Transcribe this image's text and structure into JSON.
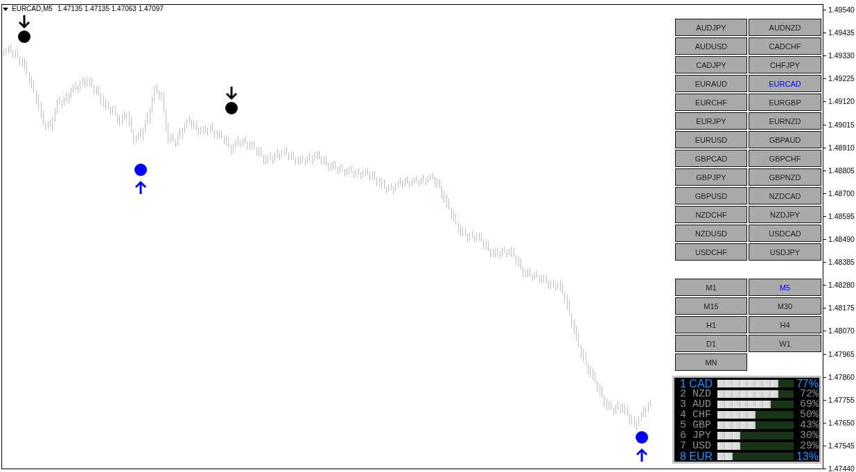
{
  "header": {
    "symbol": "EURCAD,M5",
    "ohlc": "1.47135 1.47135 1.47063 1.47097"
  },
  "chart": {
    "signals": [
      {
        "kind": "sell"
      },
      {
        "kind": "buy"
      },
      {
        "kind": "sell"
      },
      {
        "kind": "buy"
      }
    ],
    "price_scale": [
      "1.49540",
      "1.49435",
      "1.49330",
      "1.49225",
      "1.49120",
      "1.49015",
      "1.48910",
      "1.48805",
      "1.48700",
      "1.48595",
      "1.48490",
      "1.48385",
      "1.48280",
      "1.48175",
      "1.48070",
      "1.47965",
      "1.47860",
      "1.47755",
      "1.47650",
      "1.47545",
      "1.47440"
    ]
  },
  "symbols": [
    {
      "label": "AUDJPY",
      "selected": false
    },
    {
      "label": "AUDNZD",
      "selected": false
    },
    {
      "label": "AUDUSD",
      "selected": false
    },
    {
      "label": "CADCHF",
      "selected": false
    },
    {
      "label": "CADJPY",
      "selected": false
    },
    {
      "label": "CHFJPY",
      "selected": false
    },
    {
      "label": "EURAUD",
      "selected": false
    },
    {
      "label": "EURCAD",
      "selected": true
    },
    {
      "label": "EURCHF",
      "selected": false
    },
    {
      "label": "EURGBP",
      "selected": false
    },
    {
      "label": "EURJPY",
      "selected": false
    },
    {
      "label": "EURNZD",
      "selected": false
    },
    {
      "label": "EURUSD",
      "selected": false
    },
    {
      "label": "GBPAUD",
      "selected": false
    },
    {
      "label": "GBPCAD",
      "selected": false
    },
    {
      "label": "GBPCHF",
      "selected": false
    },
    {
      "label": "GBPJPY",
      "selected": false
    },
    {
      "label": "GBPNZD",
      "selected": false
    },
    {
      "label": "GBPUSD",
      "selected": false
    },
    {
      "label": "NZDCAD",
      "selected": false
    },
    {
      "label": "NZDCHF",
      "selected": false
    },
    {
      "label": "NZDJPY",
      "selected": false
    },
    {
      "label": "NZDUSD",
      "selected": false
    },
    {
      "label": "USDCAD",
      "selected": false
    },
    {
      "label": "USDCHF",
      "selected": false
    },
    {
      "label": "USDJPY",
      "selected": false
    }
  ],
  "timeframes": [
    {
      "label": "M1",
      "selected": false
    },
    {
      "label": "M5",
      "selected": true
    },
    {
      "label": "M15",
      "selected": false
    },
    {
      "label": "M30",
      "selected": false
    },
    {
      "label": "H1",
      "selected": false
    },
    {
      "label": "H4",
      "selected": false
    },
    {
      "label": "D1",
      "selected": false
    },
    {
      "label": "W1",
      "selected": false
    },
    {
      "label": "MN",
      "selected": false
    }
  ],
  "strength": [
    {
      "label": "1 CAD",
      "level": 0.8,
      "percent": "77%",
      "highlighted": true
    },
    {
      "label": "2 NZD",
      "level": 0.8,
      "percent": "72%",
      "highlighted": false
    },
    {
      "label": "3 AUD",
      "level": 0.7,
      "percent": "69%",
      "highlighted": false
    },
    {
      "label": "4 CHF",
      "level": 0.5,
      "percent": "50%",
      "highlighted": false
    },
    {
      "label": "5 GBP",
      "level": 0.5,
      "percent": "43%",
      "highlighted": false
    },
    {
      "label": "6 JPY",
      "level": 0.3,
      "percent": "30%",
      "highlighted": false
    },
    {
      "label": "7 USD",
      "level": 0.3,
      "percent": "29%",
      "highlighted": false
    },
    {
      "label": "8 EUR",
      "level": 0.2,
      "percent": "13%",
      "highlighted": true
    }
  ]
}
